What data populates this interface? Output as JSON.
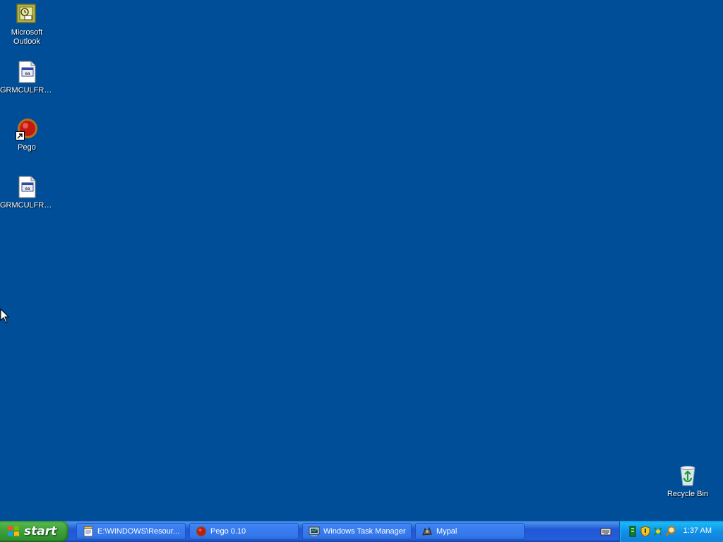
{
  "desktop": {
    "icons": [
      {
        "label": "Microsoft Outlook",
        "icon": "outlook-icon"
      },
      {
        "label": "GRMCULFRE...",
        "icon": "document-icon"
      },
      {
        "label": "Pego",
        "icon": "pego-icon"
      },
      {
        "label": "GRMCULFRE...",
        "icon": "document-icon"
      },
      {
        "label": "Recycle Bin",
        "icon": "recycle-bin-icon"
      }
    ],
    "background_color": "#004e98"
  },
  "taskbar": {
    "start_label": "start",
    "tasks": [
      {
        "label": "E:\\WINDOWS\\Resour...",
        "icon": "notepad-icon"
      },
      {
        "label": "Pego 0.10",
        "icon": "pego-icon"
      },
      {
        "label": "Windows Task Manager",
        "icon": "task-manager-icon"
      },
      {
        "label": "Mypal",
        "icon": "mypal-icon"
      }
    ],
    "tray": {
      "icons": [
        "keyboard-icon",
        "network-icon",
        "security-shield-icon",
        "update-icon",
        "search-icon"
      ],
      "clock": "1:37 AM"
    }
  }
}
